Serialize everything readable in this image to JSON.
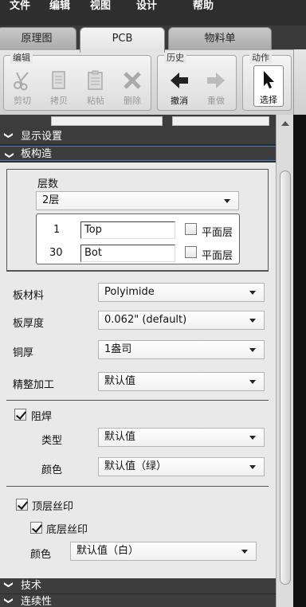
{
  "menubar": {
    "items": [
      "文件",
      "编辑",
      "视图",
      "设计",
      "帮助"
    ]
  },
  "tabs": [
    {
      "label": "原理图",
      "active": false
    },
    {
      "label": "PCB",
      "active": true
    },
    {
      "label": "物料单",
      "active": false
    }
  ],
  "ribbon": {
    "groups": [
      {
        "label": "编辑",
        "buttons": [
          {
            "label": "剪切",
            "icon": "scissors-icon",
            "enabled": false
          },
          {
            "label": "拷贝",
            "icon": "copy-icon",
            "enabled": false
          },
          {
            "label": "粘帖",
            "icon": "paste-icon",
            "enabled": false
          },
          {
            "label": "删除",
            "icon": "delete-x-icon",
            "enabled": false
          }
        ]
      },
      {
        "label": "历史",
        "buttons": [
          {
            "label": "撤消",
            "icon": "undo-arrow-icon",
            "enabled": true
          },
          {
            "label": "重做",
            "icon": "redo-arrow-icon",
            "enabled": false
          }
        ]
      },
      {
        "label": "动作",
        "buttons": [
          {
            "label": "选择",
            "icon": "pointer-cursor-icon",
            "enabled": true,
            "selected": true
          }
        ]
      }
    ]
  },
  "sections": {
    "display": {
      "label": "显示设置",
      "expanded": false
    },
    "board": {
      "label": "板构造",
      "expanded": true
    },
    "tech": {
      "label": "技术",
      "expanded": false
    },
    "continuity": {
      "label": "连续性",
      "expanded": false
    }
  },
  "board": {
    "layer_count_label": "层数",
    "layer_count_value": "2层",
    "layers": [
      {
        "number": "1",
        "name": "Top",
        "plane_label": "平面层",
        "plane_checked": false
      },
      {
        "number": "30",
        "name": "Bot",
        "plane_label": "平面层",
        "plane_checked": false
      }
    ],
    "material_label": "板材料",
    "material_value": "Polyimide",
    "thickness_label": "板厚度",
    "thickness_value": "0.062\" (default)",
    "copper_label": "铜厚",
    "copper_value": "1盎司",
    "finish_label": "精整加工",
    "finish_value": "默认值",
    "soldermask": {
      "label": "阻焊",
      "checked": true,
      "type_label": "类型",
      "type_value": "默认值",
      "color_label": "颜色",
      "color_value": "默认值（绿）"
    },
    "silkscreen": {
      "top_label": "顶层丝印",
      "top_checked": true,
      "bottom_label": "底层丝印",
      "bottom_checked": true,
      "color_label": "颜色",
      "color_value": "默认值（白）"
    }
  },
  "colors": {
    "menubar": "#2e2e2e",
    "panel": "#e9e9e9",
    "section_header": "#3d3d3d",
    "accent_border": "#4a7fbf"
  }
}
